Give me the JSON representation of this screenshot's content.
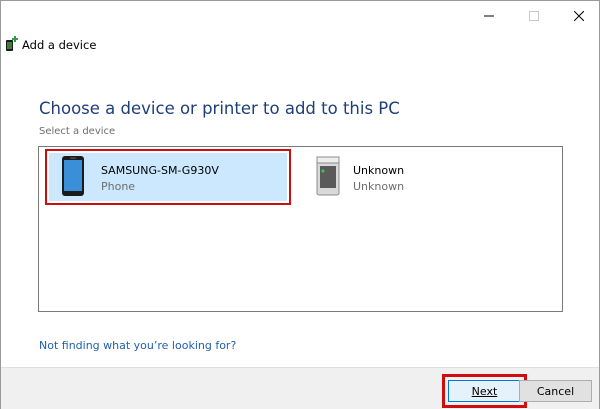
{
  "window": {
    "title": "Add a device",
    "controls": {
      "minimize": "minimize",
      "maximize": "maximize",
      "close": "close"
    }
  },
  "main": {
    "heading": "Choose a device or printer to add to this PC",
    "subheading": "Select a device",
    "devices": [
      {
        "name": "SAMSUNG-SM-G930V",
        "type": "Phone",
        "icon": "phone-icon",
        "selected": true
      },
      {
        "name": "Unknown",
        "type": "Unknown",
        "icon": "tower-pc-icon",
        "selected": false
      }
    ],
    "help_link": "Not finding what you’re looking for?"
  },
  "footer": {
    "next_label": "Next",
    "cancel_label": "Cancel"
  },
  "colors": {
    "heading": "#1e3f7a",
    "selection_bg": "#cce8ff",
    "highlight_red": "#d00d0d",
    "link": "#1f5fb0"
  }
}
